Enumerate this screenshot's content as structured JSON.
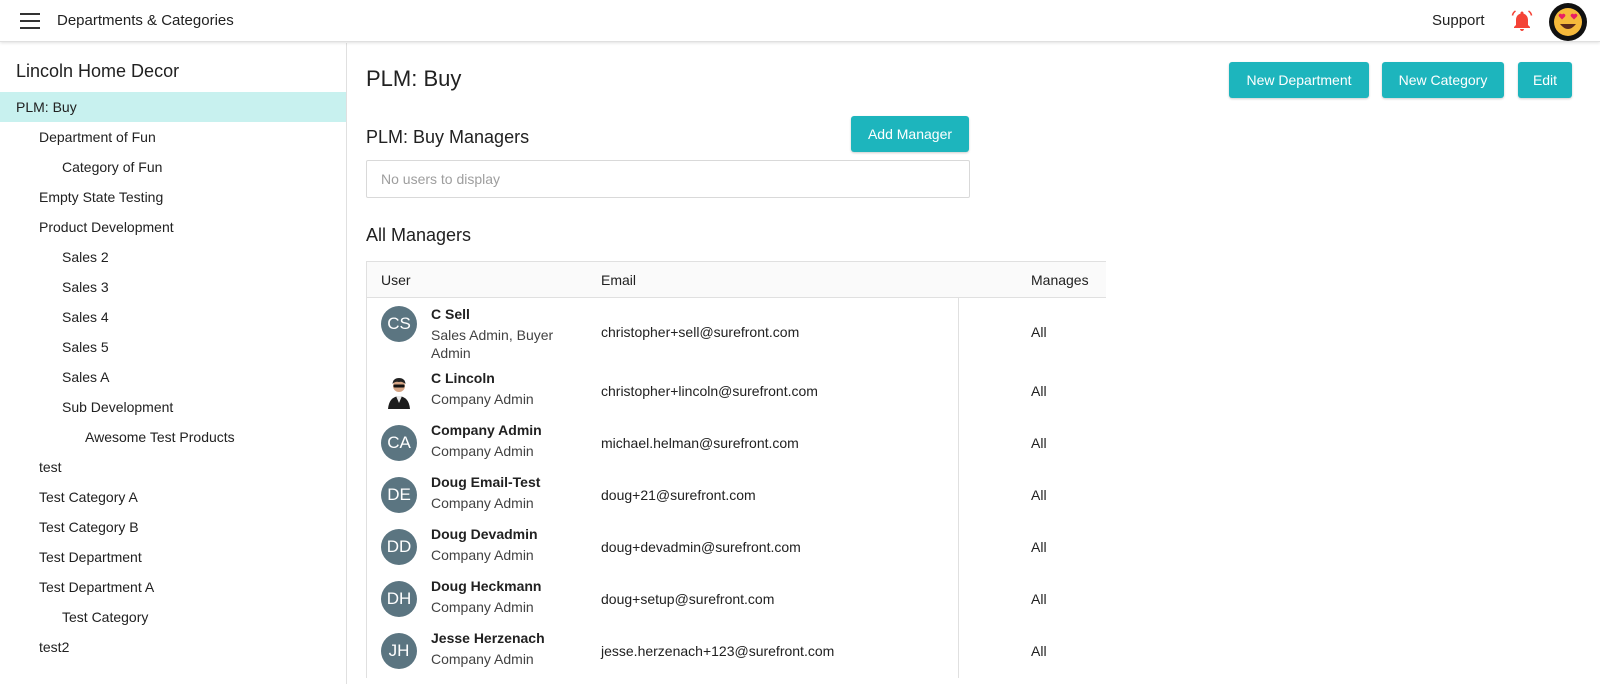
{
  "header": {
    "title": "Departments & Categories",
    "support_label": "Support",
    "menu_icon": "hamburger-menu-icon",
    "notification_icon": "bell-icon",
    "notification_color": "#f44336",
    "avatar_icon": "smiling-face-with-heart-eyes-icon"
  },
  "sidebar": {
    "org_name": "Lincoln Home Decor",
    "items": [
      {
        "label": "PLM: Buy",
        "level": 0,
        "selected": true
      },
      {
        "label": "Department of Fun",
        "level": 1
      },
      {
        "label": "Category of Fun",
        "level": 2
      },
      {
        "label": "Empty State Testing",
        "level": 1
      },
      {
        "label": "Product Development",
        "level": 1
      },
      {
        "label": "Sales 2",
        "level": 2
      },
      {
        "label": "Sales 3",
        "level": 2
      },
      {
        "label": "Sales 4",
        "level": 2
      },
      {
        "label": "Sales 5",
        "level": 2
      },
      {
        "label": "Sales A",
        "level": 2
      },
      {
        "label": "Sub Development",
        "level": 2
      },
      {
        "label": "Awesome Test Products",
        "level": 3
      },
      {
        "label": "test",
        "level": 1
      },
      {
        "label": "Test Category A",
        "level": 1
      },
      {
        "label": "Test Category B",
        "level": 1
      },
      {
        "label": "Test Department",
        "level": 1
      },
      {
        "label": "Test Department A",
        "level": 1
      },
      {
        "label": "Test Category",
        "level": 2
      },
      {
        "label": "test2",
        "level": 1
      }
    ]
  },
  "main": {
    "title": "PLM: Buy",
    "buttons": {
      "new_department": "New Department",
      "new_category": "New Category",
      "edit": "Edit",
      "add_manager": "Add Manager"
    },
    "accent_color": "#1db5bd",
    "managers_title": "PLM: Buy Managers",
    "empty_text": "No users to display",
    "all_managers_title": "All Managers",
    "table": {
      "columns": [
        "User",
        "Email",
        "Manages"
      ],
      "rows": [
        {
          "initials": "CS",
          "name": "C Sell",
          "role": "Sales Admin, Buyer Admin",
          "email": "christopher+sell@surefront.com",
          "manages": "All"
        },
        {
          "initials": "",
          "photo": true,
          "name": "C Lincoln",
          "role": "Company Admin",
          "email": "christopher+lincoln@surefront.com",
          "manages": "All"
        },
        {
          "initials": "CA",
          "name": "Company Admin",
          "role": "Company Admin",
          "email": "michael.helman@surefront.com",
          "manages": "All"
        },
        {
          "initials": "DE",
          "name": "Doug Email-Test",
          "role": "Company Admin",
          "email": "doug+21@surefront.com",
          "manages": "All"
        },
        {
          "initials": "DD",
          "name": "Doug Devadmin",
          "role": "Company Admin",
          "email": "doug+devadmin@surefront.com",
          "manages": "All"
        },
        {
          "initials": "DH",
          "name": "Doug Heckmann",
          "role": "Company Admin",
          "email": "doug+setup@surefront.com",
          "manages": "All"
        },
        {
          "initials": "JH",
          "name": "Jesse Herzenach",
          "role": "Company Admin",
          "email": "jesse.herzenach+123@surefront.com",
          "manages": "All"
        }
      ]
    }
  }
}
